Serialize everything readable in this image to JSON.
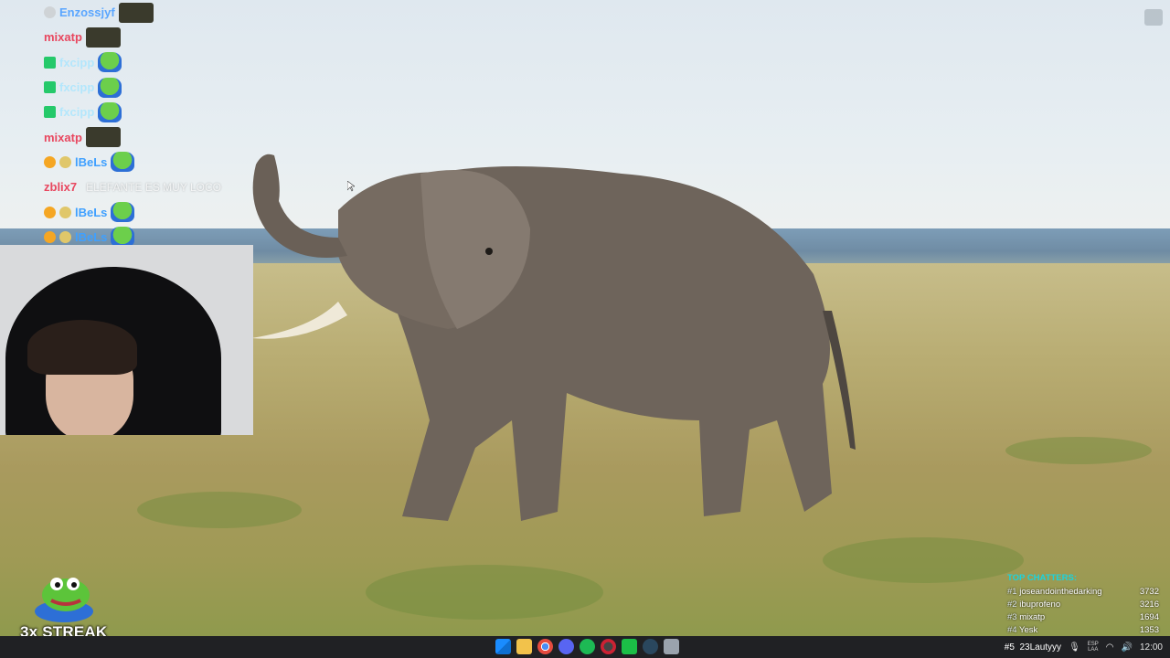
{
  "chat": {
    "messages": [
      {
        "username": "Enzossjyf",
        "color": "#5aa6ff",
        "badge": "smile-badge",
        "emote": "dark",
        "text": ""
      },
      {
        "username": "mixatp",
        "color": "#e8475f",
        "badge": "",
        "emote": "dark",
        "text": ""
      },
      {
        "username": "fxcipp",
        "color": "#7fd3ff",
        "badge": "green-badge",
        "emote": "frog",
        "text": ""
      },
      {
        "username": "fxcipp",
        "color": "#7fd3ff",
        "badge": "green-badge",
        "emote": "frog",
        "text": ""
      },
      {
        "username": "fxcipp",
        "color": "#7fd3ff",
        "badge": "green-badge",
        "emote": "frog",
        "text": ""
      },
      {
        "username": "mixatp",
        "color": "#e8475f",
        "badge": "",
        "emote": "dark",
        "text": ""
      },
      {
        "username": "lBeLs",
        "color": "#3fa0ff",
        "badge": "orange-badge",
        "emote": "frog",
        "text": ""
      },
      {
        "username": "zblix7",
        "color": "#e8475f",
        "badge": "",
        "emote": "none",
        "text": "ELEFANTE ES MUY LOCO"
      },
      {
        "username": "lBeLs",
        "color": "#3fa0ff",
        "badge": "orange-badge",
        "emote": "frog",
        "text": ""
      },
      {
        "username": "lBeLs",
        "color": "#3fa0ff",
        "badge": "orange-badge",
        "emote": "frog",
        "text": ""
      }
    ]
  },
  "streak": {
    "label": "3x STREAK",
    "icon": "frog-emote"
  },
  "top_chatters": {
    "title": "TOP CHATTERS:",
    "rows": [
      {
        "rank": "#1",
        "name": "joseandointhedarking",
        "count": "3732"
      },
      {
        "rank": "#2",
        "name": "ibuprofeno",
        "count": "3216"
      },
      {
        "rank": "#3",
        "name": "mixatp",
        "count": "1694"
      },
      {
        "rank": "#4",
        "name": "Yesk",
        "count": "1353"
      }
    ]
  },
  "taskbar": {
    "rank_label": "#5",
    "rank_name": "23Lautyyy",
    "lang_top": "ESP",
    "lang_bottom": "LAA",
    "clock": "12:00",
    "apps": [
      "windows-start-icon",
      "file-explorer-icon",
      "chrome-icon",
      "discord-icon",
      "spotify-icon",
      "obs-icon",
      "green-app-icon",
      "steam-icon",
      "extra-app-icon"
    ]
  },
  "colors": {
    "chatter_title": "#19d4e0",
    "taskbar_bg": "#202124"
  }
}
